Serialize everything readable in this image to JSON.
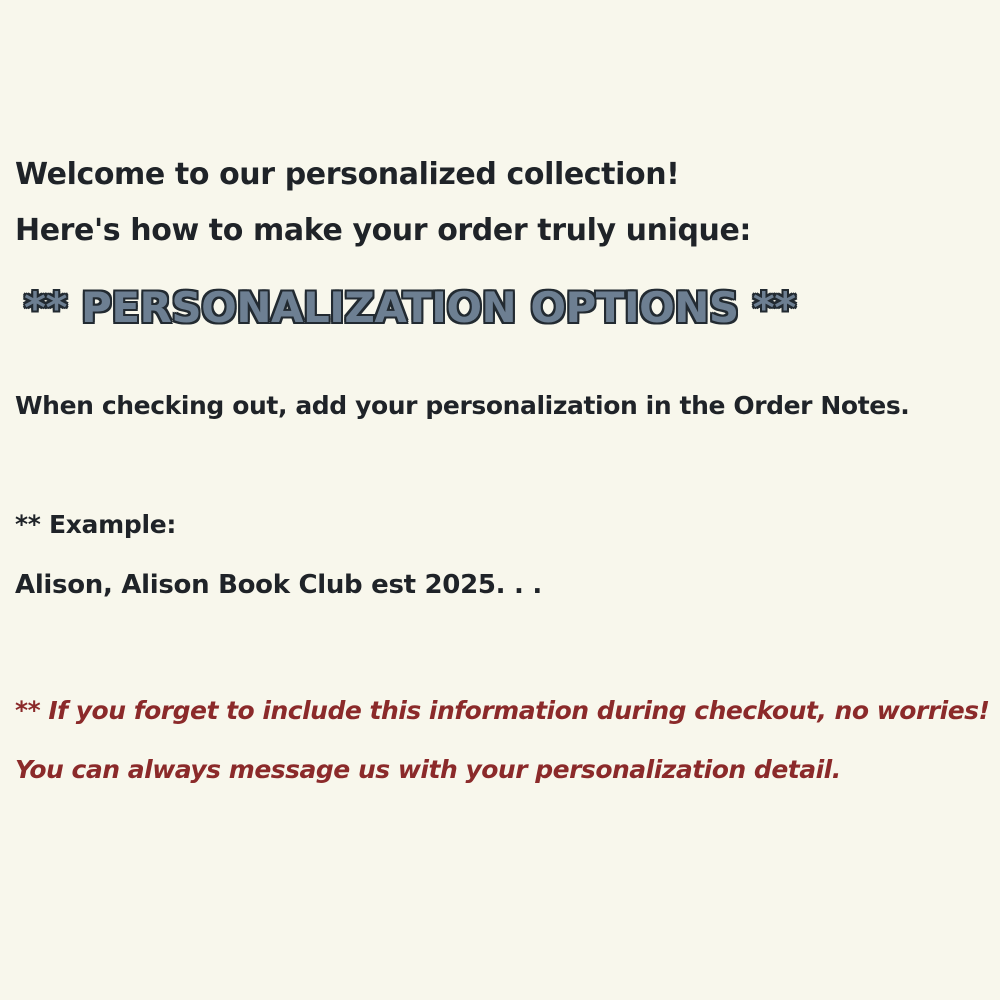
{
  "intro": {
    "line1": "Welcome to our personalized collection!",
    "line2": "Here's how to make your order truly unique:"
  },
  "heading": "** PERSONALIZATION OPTIONS **",
  "instruction": "When checking out, add your personalization in the Order Notes.",
  "example": {
    "label": "** Example:",
    "text": "Alison, Alison Book Club est 2025. . ."
  },
  "note": {
    "line1": "** If you forget to include this information during checkout, no worries!",
    "line2": "You can always message us with your personalization detail."
  },
  "colors": {
    "background": "#f8f7ec",
    "text": "#1f2328",
    "heading_fill": "#6d7f92",
    "heading_outline": "#222a31",
    "note": "#8b2a2a"
  }
}
